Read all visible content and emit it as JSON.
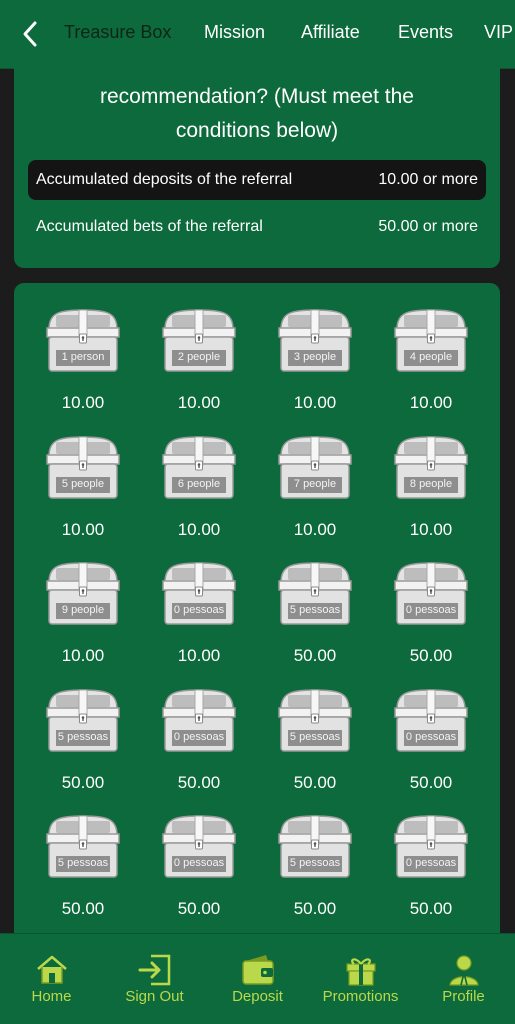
{
  "topbar": {
    "tabs": [
      {
        "label": "Treasure Box",
        "active": true
      },
      {
        "label": "Mission",
        "active": false
      },
      {
        "label": "Affiliate",
        "active": false
      },
      {
        "label": "Events",
        "active": false
      },
      {
        "label": "VIP",
        "active": false
      }
    ]
  },
  "condition": {
    "title": "recommendation? (Must meet the\nconditions below)",
    "rows": [
      {
        "label": "Accumulated deposits of the referral",
        "value": "10.00 or more"
      },
      {
        "label": "Accumulated bets of the referral",
        "value": "50.00 or more"
      }
    ]
  },
  "boxes": [
    {
      "label": "1 person",
      "amount": "10.00"
    },
    {
      "label": "2 people",
      "amount": "10.00"
    },
    {
      "label": "3 people",
      "amount": "10.00"
    },
    {
      "label": "4 people",
      "amount": "10.00"
    },
    {
      "label": "5 people",
      "amount": "10.00"
    },
    {
      "label": "6 people",
      "amount": "10.00"
    },
    {
      "label": "7 people",
      "amount": "10.00"
    },
    {
      "label": "8 people",
      "amount": "10.00"
    },
    {
      "label": "9 people",
      "amount": "10.00"
    },
    {
      "label": "0 pessoas",
      "amount": "10.00"
    },
    {
      "label": "5 pessoas",
      "amount": "50.00"
    },
    {
      "label": "0 pessoas",
      "amount": "50.00"
    },
    {
      "label": "5 pessoas",
      "amount": "50.00"
    },
    {
      "label": "0 pessoas",
      "amount": "50.00"
    },
    {
      "label": "5 pessoas",
      "amount": "50.00"
    },
    {
      "label": "0 pessoas",
      "amount": "50.00"
    },
    {
      "label": "5 pessoas",
      "amount": "50.00"
    },
    {
      "label": "0 pessoas",
      "amount": "50.00"
    },
    {
      "label": "5 pessoas",
      "amount": "50.00"
    },
    {
      "label": "0 pessoas",
      "amount": "50.00"
    }
  ],
  "bottomnav": {
    "items": [
      {
        "label": "Home",
        "icon": "home-icon"
      },
      {
        "label": "Sign Out",
        "icon": "sign-out-icon"
      },
      {
        "label": "Deposit",
        "icon": "wallet-icon"
      },
      {
        "label": "Promotions",
        "icon": "gift-icon"
      },
      {
        "label": "Profile",
        "icon": "profile-icon"
      }
    ]
  },
  "colors": {
    "primary": "#0c6a3c",
    "accent": "#b9d94a",
    "background": "#1c1c1c"
  }
}
